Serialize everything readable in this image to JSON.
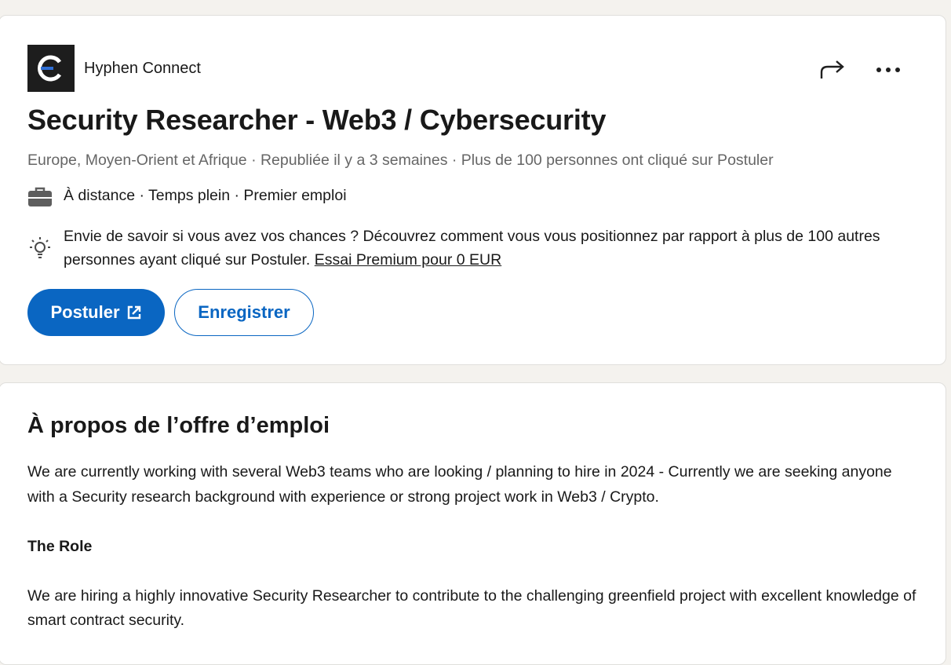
{
  "company": {
    "name": "Hyphen Connect",
    "logo_icon": "hyphen-connect-logo"
  },
  "header_actions": {
    "share_icon": "share-icon",
    "more_icon": "more-icon"
  },
  "job": {
    "title": "Security Researcher - Web3 / Cybersecurity",
    "meta": "Europe, Moyen-Orient et Afrique · Republiée il y a 3 semaines · Plus de 100 personnes ont cliqué sur Postuler",
    "type_text": "À distance · Temps plein · Premier emploi",
    "premium_text": "Envie de savoir si vous avez vos chances ? Découvrez comment vous vous positionnez par rapport à plus de 100 autres personnes ayant cliqué sur Postuler.",
    "premium_link": "Essai Premium pour 0 EUR"
  },
  "buttons": {
    "apply": "Postuler",
    "save": "Enregistrer"
  },
  "about": {
    "title": "À propos de l’offre d’emploi",
    "paragraph1": "We are currently working with several Web3 teams who are looking / planning to hire in 2024 - Currently we are seeking anyone with a Security research background with experience or strong project work in Web3 / Crypto.",
    "role_heading": "The Role",
    "paragraph2": "We are hiring a highly innovative Security Researcher to contribute to the challenging greenfield project with excellent knowledge of smart contract security."
  },
  "colors": {
    "brand_blue": "#0a66c2",
    "page_bg": "#f4f2ee",
    "muted_text": "#666666"
  }
}
